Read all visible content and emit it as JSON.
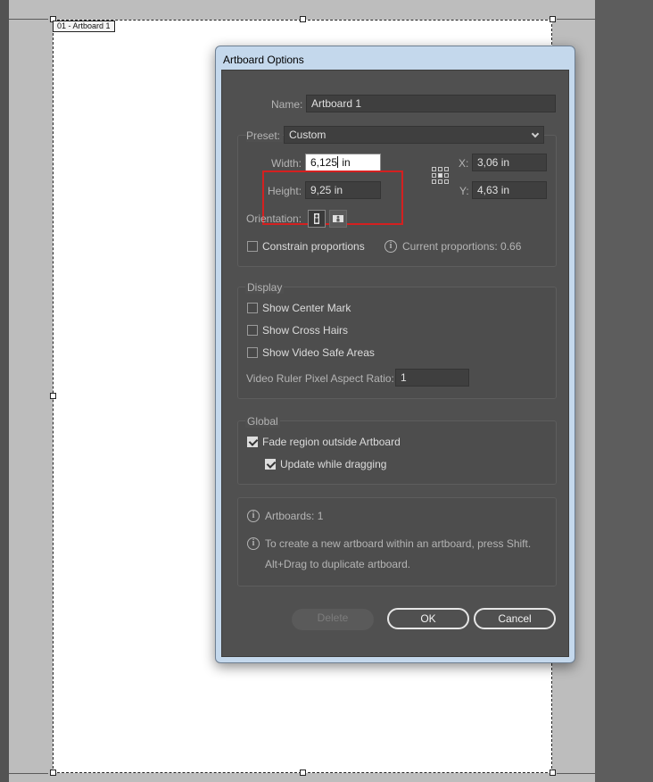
{
  "canvas": {
    "artboard_tag": "01 - Artboard 1"
  },
  "dialog": {
    "title": "Artboard Options",
    "name_label": "Name:",
    "name_value": "Artboard 1",
    "preset_label": "Preset:",
    "preset_value": "Custom",
    "width_label": "Width:",
    "width_value_before_caret": "6,125",
    "width_value_after_caret": " in",
    "height_label": "Height:",
    "height_value": "9,25 in",
    "x_label": "X:",
    "x_value": "3,06 in",
    "y_label": "Y:",
    "y_value": "4,63 in",
    "orientation_label": "Orientation:",
    "constrain_label": "Constrain proportions",
    "constrain_checked": false,
    "current_proportions": "Current proportions: 0.66",
    "display": {
      "title": "Display",
      "show_center_mark": "Show Center Mark",
      "show_cross_hairs": "Show Cross Hairs",
      "show_video_safe_areas": "Show Video Safe Areas",
      "pixel_ratio_label": "Video Ruler Pixel Aspect Ratio:",
      "pixel_ratio_value": "1"
    },
    "global": {
      "title": "Global",
      "fade_region": "Fade region outside Artboard",
      "fade_checked": true,
      "update_dragging": "Update while dragging",
      "update_checked": true
    },
    "info": {
      "artboards": "Artboards: 1",
      "tip_line1": "To create a new artboard within an artboard, press Shift.",
      "tip_line2": "Alt+Drag to duplicate artboard."
    },
    "buttons": {
      "delete": "Delete",
      "ok": "OK",
      "cancel": "Cancel"
    }
  },
  "colors": {
    "dialog_bg": "#505050",
    "highlight": "#d42020"
  },
  "icons": {
    "info": "info-icon",
    "portrait": "portrait-orientation-icon",
    "landscape": "landscape-orientation-icon",
    "reference_point": "reference-point-icon",
    "dropdown": "chevron-down-icon"
  }
}
